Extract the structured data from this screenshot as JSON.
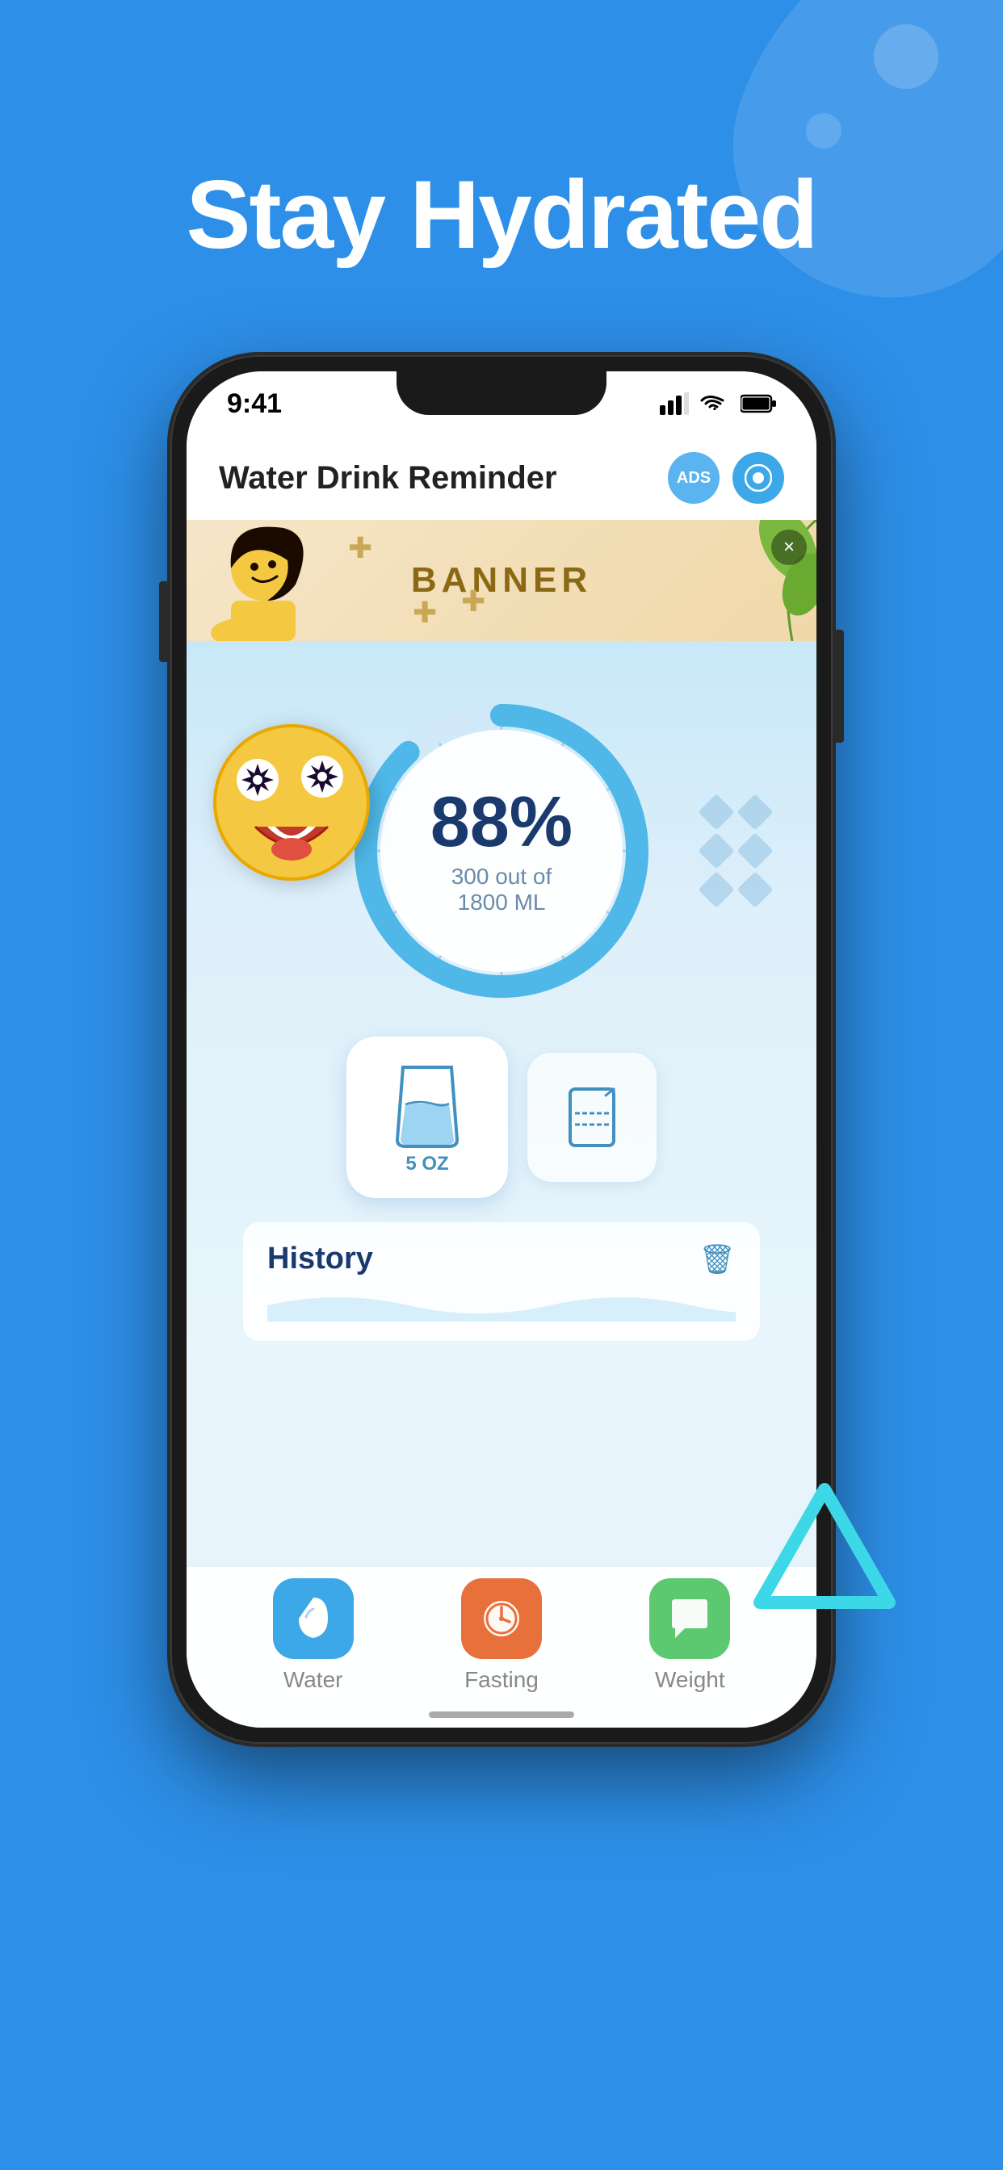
{
  "background_color": "#2d8fe8",
  "headline": "Stay Hydrated",
  "phone": {
    "status_bar": {
      "time": "9:41",
      "signal": "▋▋▋",
      "wifi": "WiFi",
      "battery": "🔋"
    },
    "app_header": {
      "title": "Water Drink Reminder",
      "ads_label": "ADS",
      "settings_icon": "settings"
    },
    "banner": {
      "text": "BANNER",
      "close_icon": "×"
    },
    "progress": {
      "percent": "88%",
      "detail": "300 out of 1800 ML",
      "emoji": "🤩"
    },
    "drink_buttons": {
      "main": {
        "oz": "5\nOZ"
      },
      "secondary": {
        "icon": "custom-glass"
      }
    },
    "history": {
      "title": "History",
      "delete_icon": "🗑"
    },
    "bottom_nav": [
      {
        "id": "water",
        "label": "Water",
        "icon": "💧",
        "color": "water"
      },
      {
        "id": "fasting",
        "label": "Fasting",
        "icon": "⏰",
        "color": "fasting"
      },
      {
        "id": "weight",
        "label": "Weight",
        "icon": "💬",
        "color": "weight"
      }
    ]
  },
  "decorative": {
    "diamonds": [
      "",
      "",
      "",
      "",
      "",
      ""
    ]
  }
}
